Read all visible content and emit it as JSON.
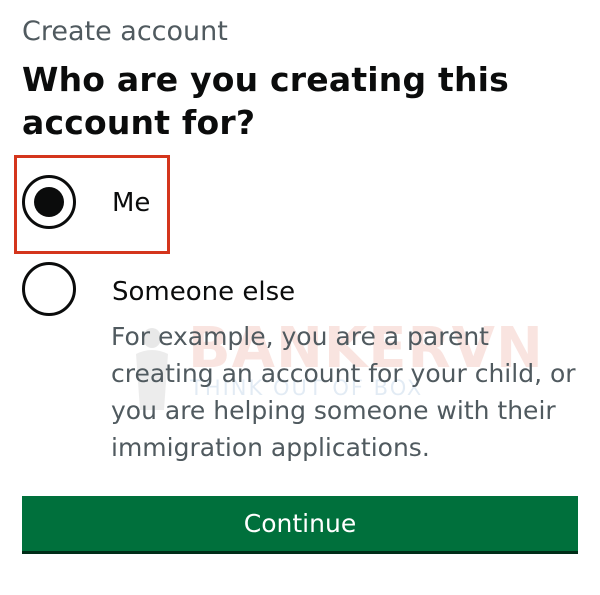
{
  "caption": "Create account",
  "heading": "Who are you creating this account for?",
  "options": [
    {
      "label": "Me",
      "selected": true
    },
    {
      "label": "Someone else",
      "selected": false,
      "hint": "For example, you are a parent creating an account for your child, or you are helping someone with their immigration applications."
    }
  ],
  "continue_label": "Continue",
  "watermark": {
    "brand": "BANKERVN",
    "tagline": "THINK OUT OF BOX"
  },
  "colors": {
    "primary_button": "#00703c",
    "highlight_border": "#d4351c",
    "text": "#0b0c0c",
    "secondary_text": "#505a5f"
  }
}
